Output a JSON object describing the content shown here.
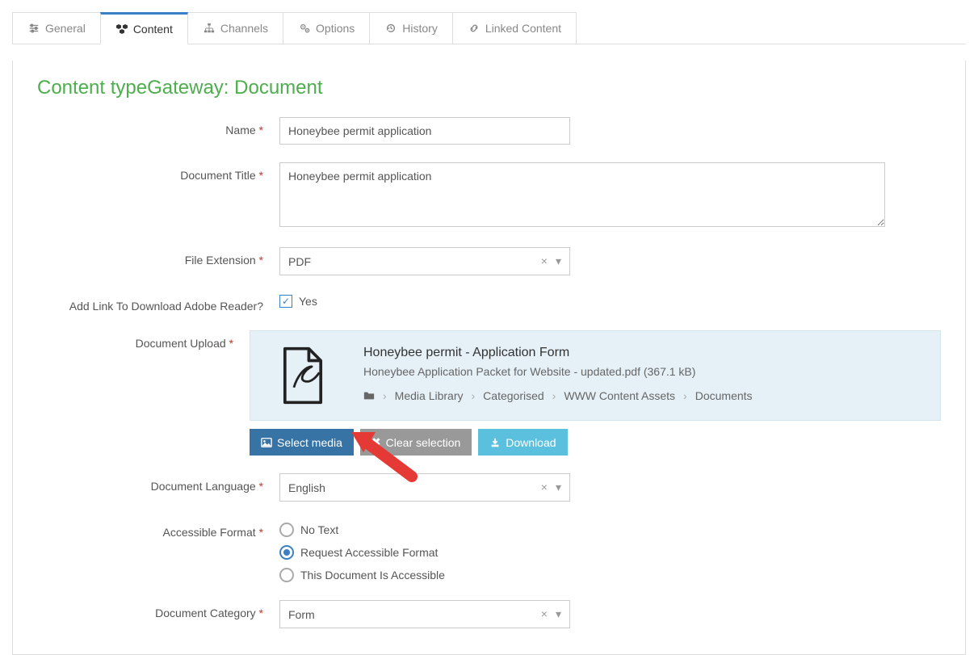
{
  "tabs": [
    {
      "label": "General"
    },
    {
      "label": "Content"
    },
    {
      "label": "Channels"
    },
    {
      "label": "Options"
    },
    {
      "label": "History"
    },
    {
      "label": "Linked Content"
    }
  ],
  "page_title": "Content typeGateway: Document",
  "form": {
    "name": {
      "label": "Name",
      "value": "Honeybee permit application"
    },
    "doc_title": {
      "label": "Document Title",
      "value": "Honeybee permit application"
    },
    "file_ext": {
      "label": "File Extension",
      "value": "PDF"
    },
    "adobe_link": {
      "label": "Add Link To Download Adobe Reader?",
      "checkbox_label": "Yes"
    },
    "doc_upload": {
      "label": "Document Upload",
      "title": "Honeybee permit - Application Form",
      "filename": "Honeybee Application Packet for Website - updated.pdf (367.1 kB)",
      "breadcrumb": [
        "Media Library",
        "Categorised",
        "WWW Content Assets",
        "Documents"
      ],
      "btn_select": "Select media",
      "btn_clear": "Clear selection",
      "btn_download": "Download"
    },
    "doc_lang": {
      "label": "Document Language",
      "value": "English"
    },
    "acc_format": {
      "label": "Accessible Format",
      "options": [
        "No Text",
        "Request Accessible Format",
        "This Document Is Accessible"
      ],
      "selected": 1
    },
    "doc_cat": {
      "label": "Document Category",
      "value": "Form"
    }
  }
}
